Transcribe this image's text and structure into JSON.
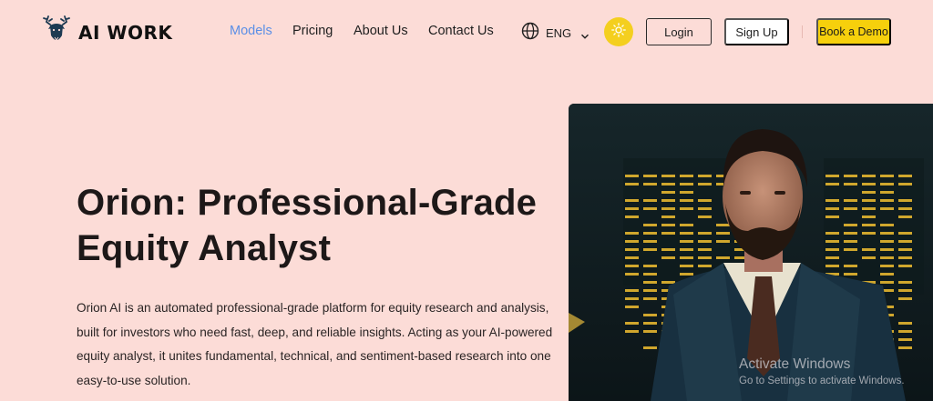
{
  "brand": {
    "name": "AI WORK",
    "logo_icon": "deer-head-icon"
  },
  "nav": {
    "links": [
      {
        "label": "Models",
        "active": true
      },
      {
        "label": "Pricing",
        "active": false
      },
      {
        "label": "About Us",
        "active": false
      },
      {
        "label": "Contact Us",
        "active": false
      }
    ],
    "language": {
      "label": "ENG",
      "icon": "globe-icon"
    },
    "theme_toggle_icon": "sun-icon",
    "login_label": "Login",
    "signup_label": "Sign Up",
    "demo_label": "Book a Demo"
  },
  "hero": {
    "title": "Orion: Professional-Grade Equity Analyst",
    "description": "Orion AI is an automated professional-grade platform for equity research and analysis, built for investors who need fast, deep, and reliable insights. Acting as your AI-powered equity analyst, it unites fundamental, technical, and sentiment-based research into one easy-to-use solution.",
    "image_subject": "bearded-man-in-suit-trading-floor"
  },
  "watermark": {
    "title": "Activate Windows",
    "subtitle": "Go to Settings to activate Windows."
  },
  "colors": {
    "background": "#fcdcd7",
    "accent_link": "#5b8fe6",
    "demo_button": "#f6d00c",
    "theme_toggle": "#f4cf1f"
  }
}
